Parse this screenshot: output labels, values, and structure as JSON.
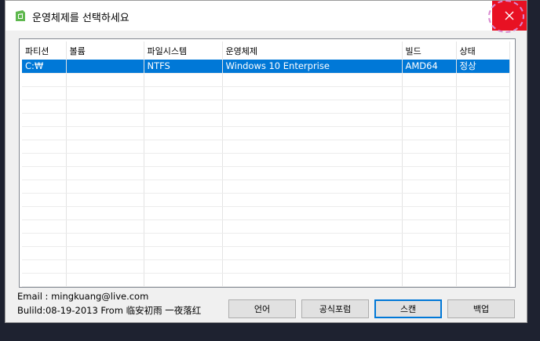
{
  "window": {
    "title": "운영체제를 선택하세요"
  },
  "columns": [
    "파티션",
    "볼륨",
    "파일시스템",
    "운영체제",
    "빌드",
    "상태"
  ],
  "rows": [
    [
      "C:₩",
      "",
      "NTFS",
      "Windows 10 Enterprise",
      "AMD64",
      "정상"
    ]
  ],
  "footer": {
    "email": "Email : mingkuang@live.com",
    "build": "Bulild:08-19-2013 From 临安初雨 一夜落红"
  },
  "buttons": {
    "language": "언어",
    "forum": "공식포럼",
    "scan": "스캔",
    "backup": "백업"
  },
  "colors": {
    "close_bg": "#e81123",
    "selection": "#0078d7",
    "app_icon": "#5fb84f"
  },
  "icons": {
    "close": "close-icon",
    "app": "app-icon"
  }
}
